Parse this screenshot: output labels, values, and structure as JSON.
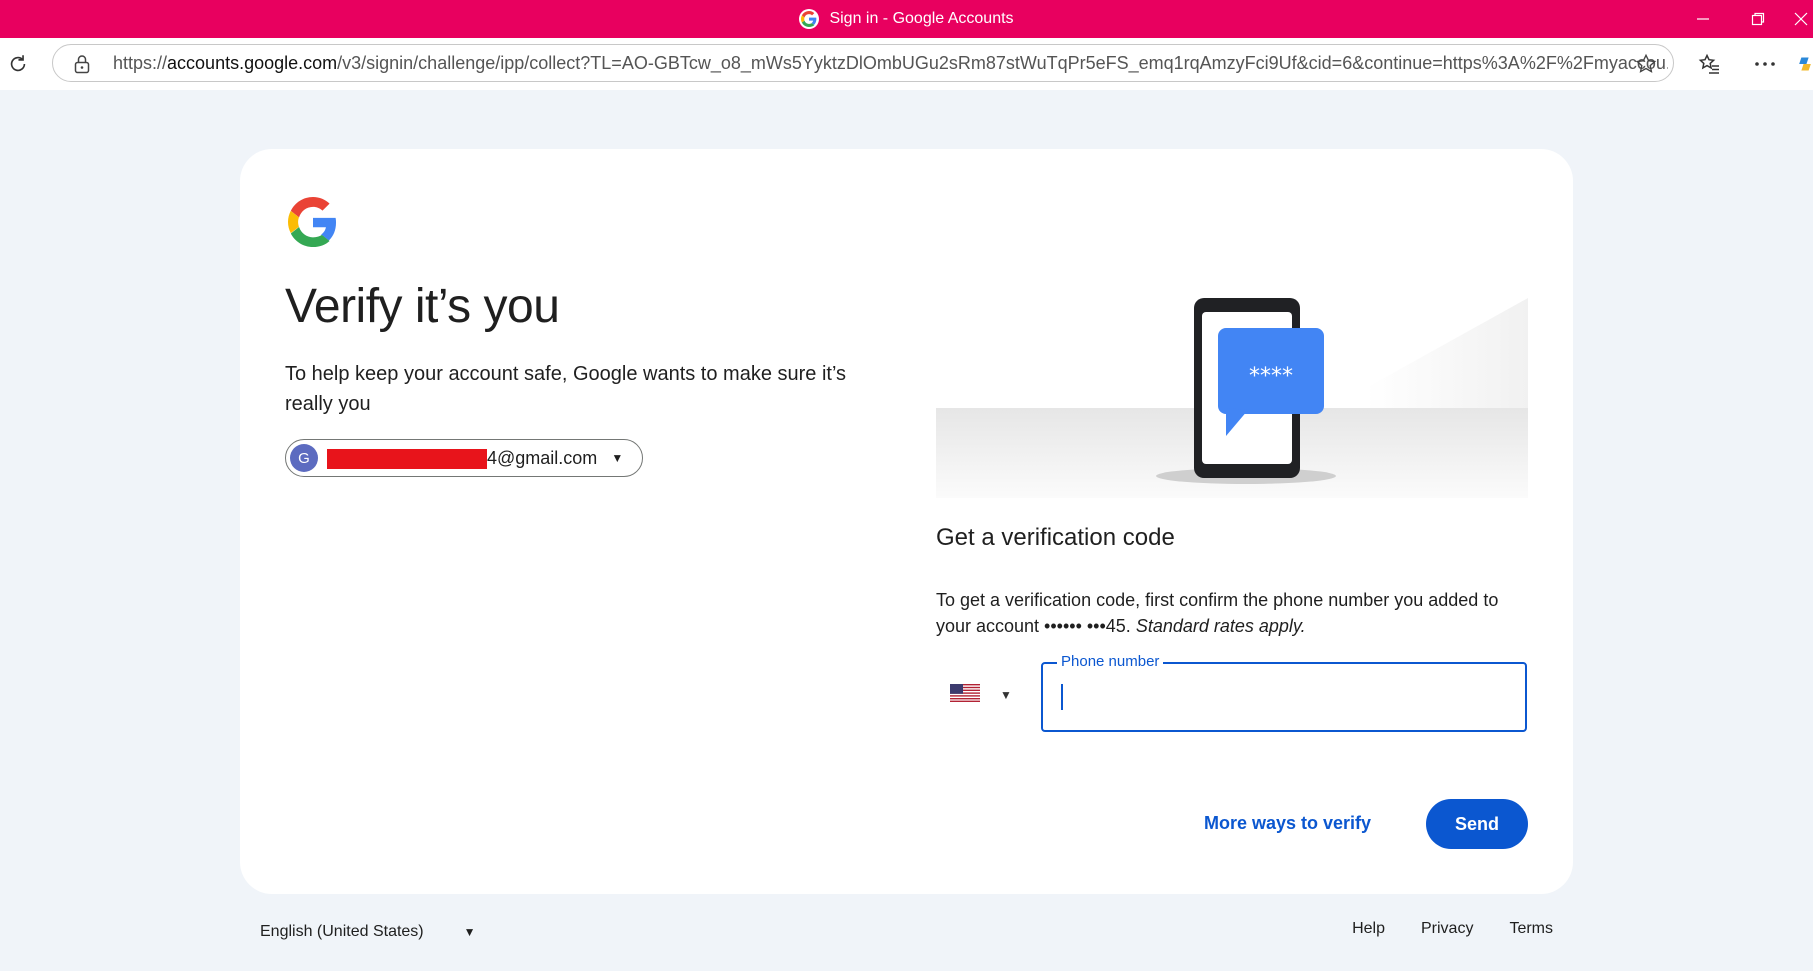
{
  "window": {
    "title": "Sign in - Google Accounts",
    "accent_color": "#e8005f"
  },
  "browser": {
    "url_scheme": "https://",
    "url_host": "accounts.google.com",
    "url_path": "/v3/signin/challenge/ipp/collect?TL=AO-GBTcw_o8_mWs5YyktzDlOmbUGu2sRm87stWuTqPr5eFS_emq1rqAmzyFci9Uf&cid=6&continue=https%3A%2F%2Fmyaccou..."
  },
  "page": {
    "heading": "Verify it’s you",
    "subtext": "To help keep your account safe, Google wants to make sure it’s really you",
    "account": {
      "avatar_letter": "G",
      "email_visible": "4@gmail.com"
    },
    "verification": {
      "title": "Get a verification code",
      "description": "To get a verification code, first confirm the phone number you added to your account •••••• •••45. ",
      "rates_note": "Standard rates apply.",
      "phone_label": "Phone number",
      "phone_value": "",
      "country": "us-flag-icon",
      "more_ways_label": "More ways to verify",
      "send_label": "Send",
      "button_color": "#0b57d0"
    }
  },
  "footer": {
    "language": "English (United States)",
    "links": [
      "Help",
      "Privacy",
      "Terms"
    ]
  }
}
